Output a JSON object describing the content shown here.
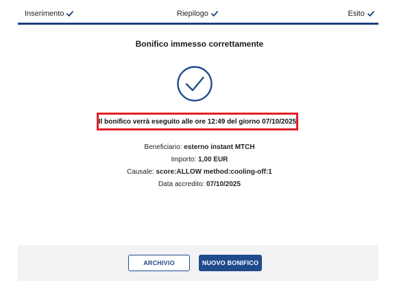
{
  "stepper": {
    "steps": [
      {
        "label": "Inserimento",
        "status": "completed"
      },
      {
        "label": "Riepilogo",
        "status": "completed"
      },
      {
        "label": "Esito",
        "status": "completed"
      }
    ],
    "accent_color": "#1a3f7a"
  },
  "result": {
    "title": "Bonifico immesso correttamente",
    "icon": "check-circle-icon",
    "execution_message": "Il bonifico verrà eseguito alle ore 12:49 del giorno 07/10/2025",
    "highlight_color": "#e41e26"
  },
  "details": {
    "beneficiary_label": "Beneficiario:",
    "beneficiary_value": "esterno instant MTCH",
    "amount_label": "Importo:",
    "amount_value": "1,00 EUR",
    "reason_label": "Causale:",
    "reason_value": "score:ALLOW method:cooling-off:1",
    "credit_date_label": "Data accredito:",
    "credit_date_value": "07/10/2025"
  },
  "footer": {
    "archive_label": "ARCHIVIO",
    "new_transfer_label": "NUOVO BONIFICO",
    "primary_color": "#1f4a8c"
  }
}
